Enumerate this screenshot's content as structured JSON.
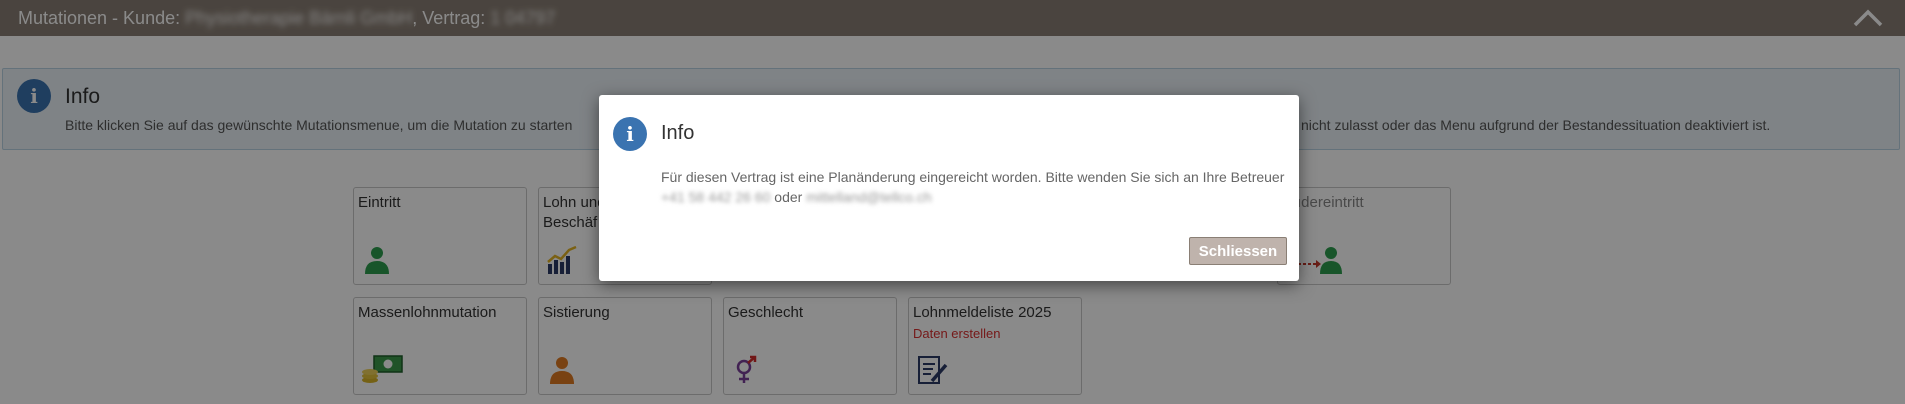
{
  "header": {
    "title_prefix": "Mutationen - Kunde: ",
    "customer_name": "Physiotherapie Bärnli GmbH",
    "contract_label": ", Vertrag: ",
    "contract_number": "1 04797"
  },
  "info_panel": {
    "title": "Info",
    "text_left": "Bitte klicken Sie auf das gewünschte Mutationsmenue, um die Mutation zu starten",
    "text_right": "nicht zulasst oder das Menu aufgrund der Bestandessituation deaktiviert ist."
  },
  "tiles": {
    "eintritt": {
      "label": "Eintritt",
      "icon": "person-icon"
    },
    "lohn": {
      "label": "Lohn und",
      "label2": "Beschäf",
      "icon": "chart-icon"
    },
    "wiedereintritt": {
      "label": "ıdereintritt",
      "icon": "person-arrow-icon"
    },
    "massenlohn": {
      "label": "Massenlohnmutation",
      "icon": "money-icon"
    },
    "sistierung": {
      "label": "Sistierung",
      "icon": "person-icon"
    },
    "geschlecht": {
      "label": "Geschlecht",
      "icon": "gender-icon"
    },
    "lohnmeldeliste": {
      "label": "Lohnmeldeliste 2025",
      "sub": "Daten erstellen",
      "icon": "document-edit-icon"
    }
  },
  "modal": {
    "title": "Info",
    "text": "Für diesen Vertrag ist eine Planänderung eingereicht worden. Bitte wenden Sie sich an Ihre Betreuer",
    "phone": "+41 58 442 26 60",
    "connector": " oder ",
    "email": "mittelland@tellco.ch",
    "close_label": "Schliessen"
  },
  "colors": {
    "header_bg": "#8a7f75",
    "info_accent": "#3a73b0",
    "alert_red": "#d93030"
  }
}
